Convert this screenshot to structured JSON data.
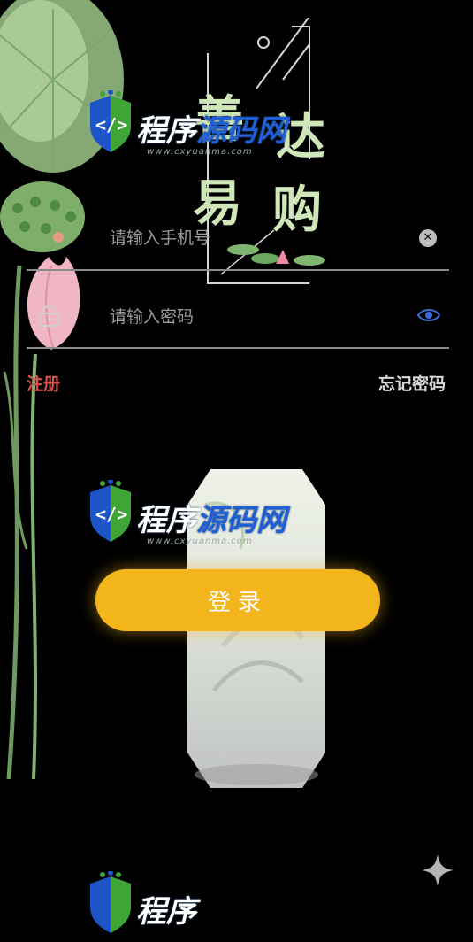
{
  "title": {
    "chars": [
      "善",
      "达",
      "易",
      "购"
    ]
  },
  "watermark": {
    "text_white": "程序",
    "text_blue": "源码网",
    "url": "www.cxyuanma.com"
  },
  "login_form": {
    "phone_placeholder": "请输入手机号",
    "password_placeholder": "请输入密码",
    "register_label": "注册",
    "forgot_label": "忘记密码",
    "login_label": "登录"
  },
  "colors": {
    "accent": "#f2b51c",
    "register": "#d9544f",
    "eye": "#3d6bd8",
    "title": "#cfe6b8"
  },
  "icons": {
    "clear": "close-circle-icon",
    "password_visibility": "eye-icon",
    "lock": "lock-open-icon",
    "sparkle": "sparkle-icon"
  }
}
